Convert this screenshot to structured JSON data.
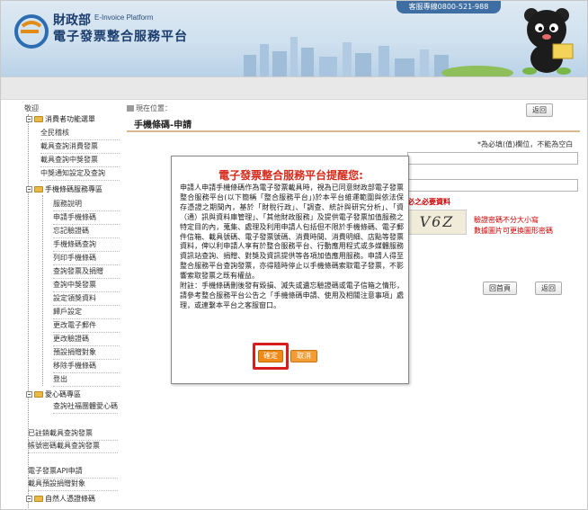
{
  "header": {
    "ministry": "財政部",
    "english": "E-Invoice Platform",
    "title": "電子發票整合服務平台",
    "hotline": "客服專線0800-521-988"
  },
  "sidebar": {
    "menu_label": "敬迎",
    "sections": [
      {
        "label": "消費者功能選單",
        "items": [
          "全民稽核",
          "載具查詢消費發票",
          "載具查詢中獎發票",
          "中獎通知設定及查詢"
        ]
      },
      {
        "label": "手機條碼服務專區",
        "items": [
          "服務說明",
          "申請手機條碼",
          "忘記驗證碼",
          "手機條碼查詢",
          "列印手機條碼",
          "查詢發票及捐贈",
          "查詢中獎發票",
          "設定領獎資料",
          "歸戶設定",
          "更改電子郵件",
          "更改驗證碼",
          "預設捐贈對象",
          "移除手機條碼",
          "登出"
        ]
      },
      {
        "label": "愛心碼專區",
        "items": [
          "查詢社福團體愛心碼"
        ]
      }
    ],
    "extra_items": [
      "已註銷載具查詢發票",
      "帳號密碼載具查詢發票",
      "電子發票API申請",
      "載具預設捐贈對象"
    ],
    "last_section": "自然人憑證條碼"
  },
  "main": {
    "breadcrumb": "現在位置：",
    "page_title": "手機條碼-申請",
    "back_top": "返回",
    "back_home": "回首頁",
    "back_bottom": "返回",
    "required_note": "*為必填(值)欄位，不能為空白",
    "must_agree": "必之必要資料",
    "captcha_text": "V6Z",
    "captcha_hint1": "驗證密碼不分大小寫",
    "captcha_hint2": "數據圖片可更換圖形密碼"
  },
  "modal": {
    "title": "電子發票整合服務平台提醒您:",
    "paragraph1": "申請人申請手機條碼作為電子發票載具時，視為已同意財政部電子發票整合服務平台(以下簡稱「整合服務平台」)於本平台維運範圍與依法保存憑證之期間內，基於「財稅行政」、「調查、統計與研究分析」、「資（通）訊與資料庫管理」、「其他財政服務」及提供電子發票加值服務之特定目的內，蒐集、處理及利用申請人包括但不限於手機條碼、電子郵件信箱、載具號碼、電子發票號碼、消費時間、消費明細、店點等發票資料，俾以利申請人享有於整合服務平台、行動應用程式或多媒體服務資訊站查詢、捐贈、對獎及資訊提供等各項加值應用服務。申請人得至整合服務平台查詢發票，亦得隨時停止以手機條碼索取電子發票，不影響索取發票之既有權益。",
    "paragraph2": "附註：手機條碼刪後發有毀損、滅失或遺忘驗證碼或電子信箱之情形，請參考整合服務平台公告之「手機條碼申請、使用及相關注意事項」處理，或連繫本平台之客服窗口。",
    "confirm_label": "確定",
    "cancel_label": "取消"
  },
  "colors": {
    "modal_title": "#d62a1c",
    "confirm_button": "#f08a16",
    "highlight_box": "#d81d1d",
    "header_title": "#1b3d6e"
  }
}
